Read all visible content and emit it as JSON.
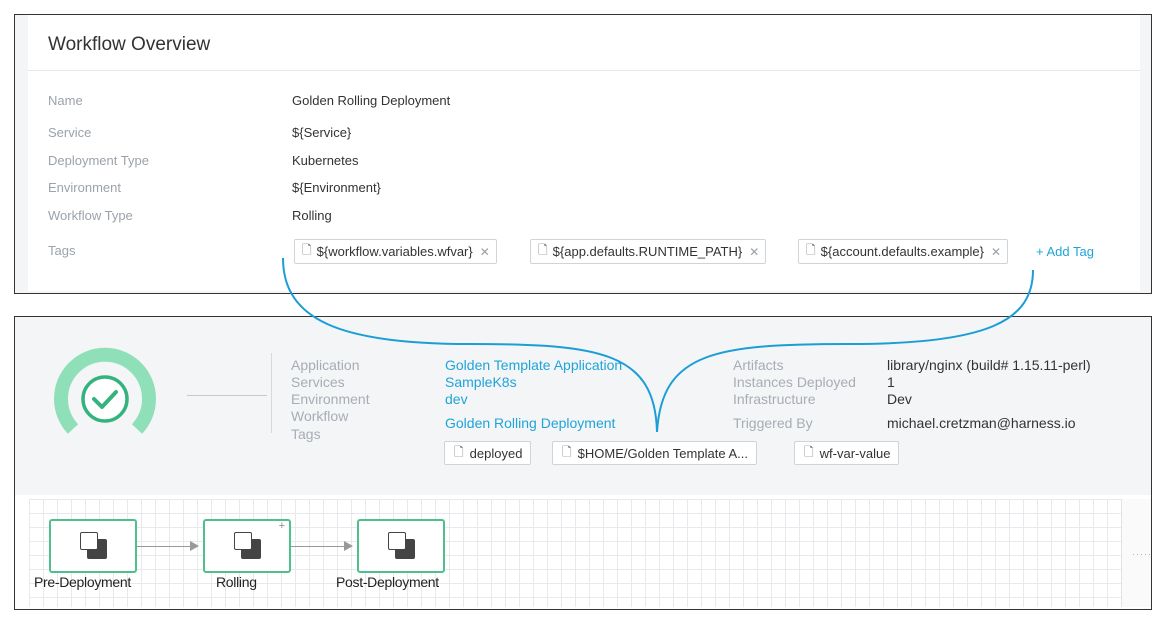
{
  "overview": {
    "title": "Workflow Overview",
    "rows": [
      {
        "label": "Name",
        "value": "Golden Rolling Deployment"
      },
      {
        "label": "Service",
        "value": "${Service}"
      },
      {
        "label": "Deployment Type",
        "value": "Kubernetes"
      },
      {
        "label": "Environment",
        "value": "${Environment}"
      },
      {
        "label": "Workflow Type",
        "value": "Rolling"
      }
    ],
    "tags_label": "Tags",
    "tags": [
      "${workflow.variables.wfvar}",
      "${app.defaults.RUNTIME_PATH}",
      "${account.defaults.example}"
    ],
    "add_tag_label": "+ Add Tag"
  },
  "deployment": {
    "status_color": "#4fc08d",
    "left_fields": [
      {
        "label": "Application",
        "value": "Golden Template Application"
      },
      {
        "label": "Services",
        "value": "SampleK8s"
      },
      {
        "label": "Environment",
        "value": "dev"
      },
      {
        "label": "Workflow",
        "value": "Golden Rolling Deployment"
      }
    ],
    "tags_label": "Tags",
    "tags": [
      "deployed",
      "$HOME/Golden Template A...",
      "wf-var-value"
    ],
    "right_fields": [
      {
        "label": "Artifacts",
        "value": "library/nginx (build# 1.15.11-perl)"
      },
      {
        "label": "Instances Deployed",
        "value": "1"
      },
      {
        "label": "Infrastructure",
        "value": "Dev"
      },
      {
        "label": "Triggered By",
        "value": "michael.cretzman@harness.io"
      }
    ]
  },
  "pipeline": {
    "stages": [
      {
        "label": "Pre-Deployment",
        "icon": "copy-icon"
      },
      {
        "label": "Rolling",
        "icon": "copy-icon"
      },
      {
        "label": "Post-Deployment",
        "icon": "copy-icon"
      }
    ]
  },
  "colors": {
    "accent_link": "#1fa4d9",
    "stage_border": "#4fc08d",
    "callout_curve": "#1b9ed6"
  }
}
